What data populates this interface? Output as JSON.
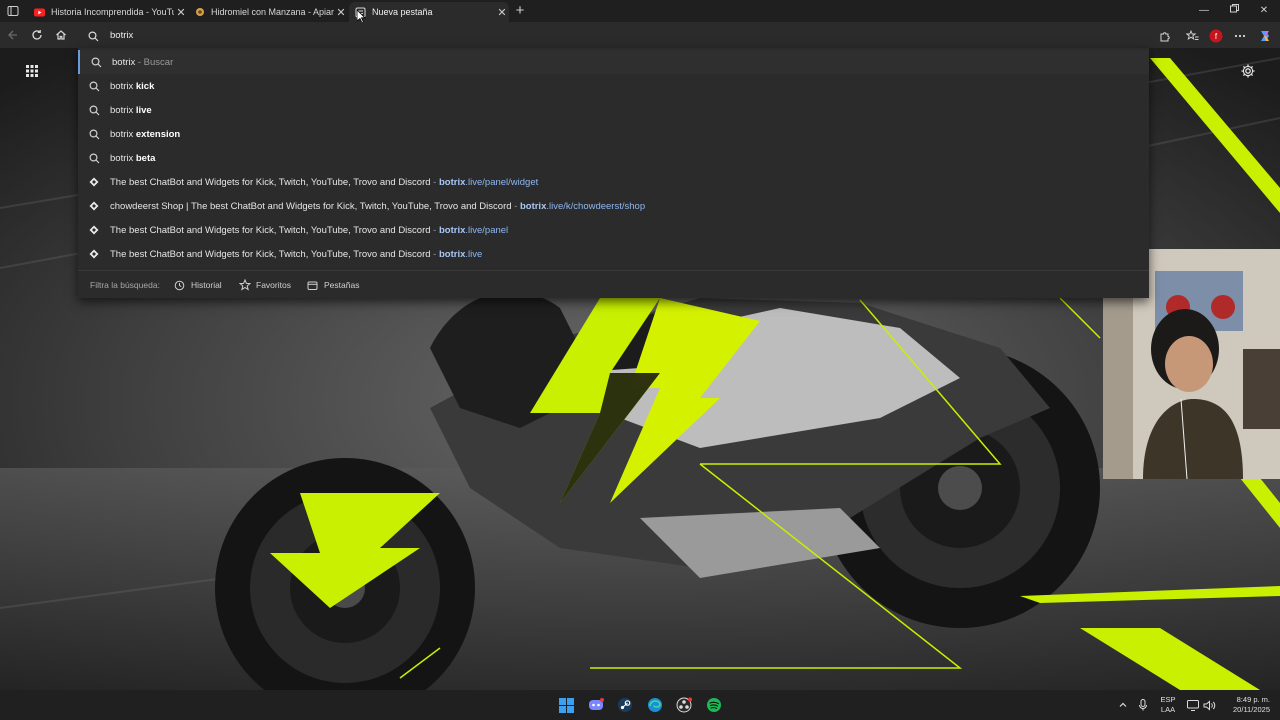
{
  "tabs": [
    {
      "title": "Historia Incomprendida - YouTube",
      "favicon": "youtube-icon",
      "active": false
    },
    {
      "title": "Hidromiel con Manzana - Apiario",
      "favicon": "site-icon",
      "active": false
    },
    {
      "title": "Nueva pestaña",
      "favicon": "new-tab-page-icon",
      "active": true
    }
  ],
  "address_bar": {
    "value": "botrix"
  },
  "suggestions": [
    {
      "type": "search",
      "prefix": "botrix",
      "bold": "",
      "suffix": " - Buscar"
    },
    {
      "type": "search",
      "prefix": "botrix ",
      "bold": "kick",
      "suffix": ""
    },
    {
      "type": "search",
      "prefix": "botrix ",
      "bold": "live",
      "suffix": ""
    },
    {
      "type": "search",
      "prefix": "botrix ",
      "bold": "extension",
      "suffix": ""
    },
    {
      "type": "search",
      "prefix": "botrix ",
      "bold": "beta",
      "suffix": ""
    },
    {
      "type": "site",
      "title": "The best ChatBot and Widgets for Kick, Twitch, YouTube, Trovo and Discord",
      "sep": " - ",
      "url_bold": "botrix",
      "url_rest": ".live/panel/widget"
    },
    {
      "type": "site",
      "title": "chowdeerst Shop | The best ChatBot and Widgets for Kick, Twitch, YouTube, Trovo and Discord",
      "sep": " - ",
      "url_bold": "botrix",
      "url_rest": ".live/k/chowdeerst/shop"
    },
    {
      "type": "site",
      "title": "The best ChatBot and Widgets for Kick, Twitch, YouTube, Trovo and Discord",
      "sep": " - ",
      "url_bold": "botrix",
      "url_rest": ".live/panel"
    },
    {
      "type": "site",
      "title": "The best ChatBot and Widgets for Kick, Twitch, YouTube, Trovo and Discord",
      "sep": " - ",
      "url_bold": "botrix",
      "url_rest": ".live"
    }
  ],
  "filter": {
    "label": "Filtra la búsqueda:",
    "chips": [
      {
        "label": "Historial",
        "icon": "history-icon"
      },
      {
        "label": "Favoritos",
        "icon": "star-icon"
      },
      {
        "label": "Pestañas",
        "icon": "tabs-icon"
      }
    ]
  },
  "tray": {
    "lang_top": "ESP",
    "lang_bottom": "LAA",
    "time": "8:49 p. m.",
    "date": "20/11/2025"
  },
  "colors": {
    "accent_lime": "#c8f000",
    "link_blue": "#8fb6f0",
    "selection_blue": "#6b9bd9"
  }
}
